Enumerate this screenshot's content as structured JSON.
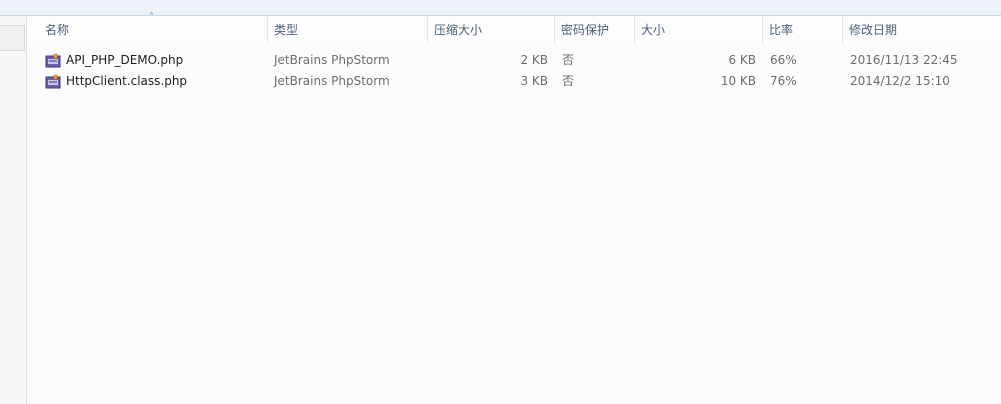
{
  "columns": {
    "name": "名称",
    "type": "类型",
    "compressed_size": "压缩大小",
    "password": "密码保护",
    "size": "大小",
    "ratio": "比率",
    "modified": "修改日期"
  },
  "sort_indicator": "˄",
  "files": [
    {
      "icon": "php-file-icon",
      "name": "API_PHP_DEMO.php",
      "type": "JetBrains PhpStorm",
      "compressed_size": "2 KB",
      "password": "否",
      "size": "6 KB",
      "ratio": "66%",
      "modified": "2016/11/13 22:45"
    },
    {
      "icon": "php-file-icon",
      "name": "HttpClient.class.php",
      "type": "JetBrains PhpStorm",
      "compressed_size": "3 KB",
      "password": "否",
      "size": "10 KB",
      "ratio": "76%",
      "modified": "2014/12/2 15:10"
    }
  ]
}
